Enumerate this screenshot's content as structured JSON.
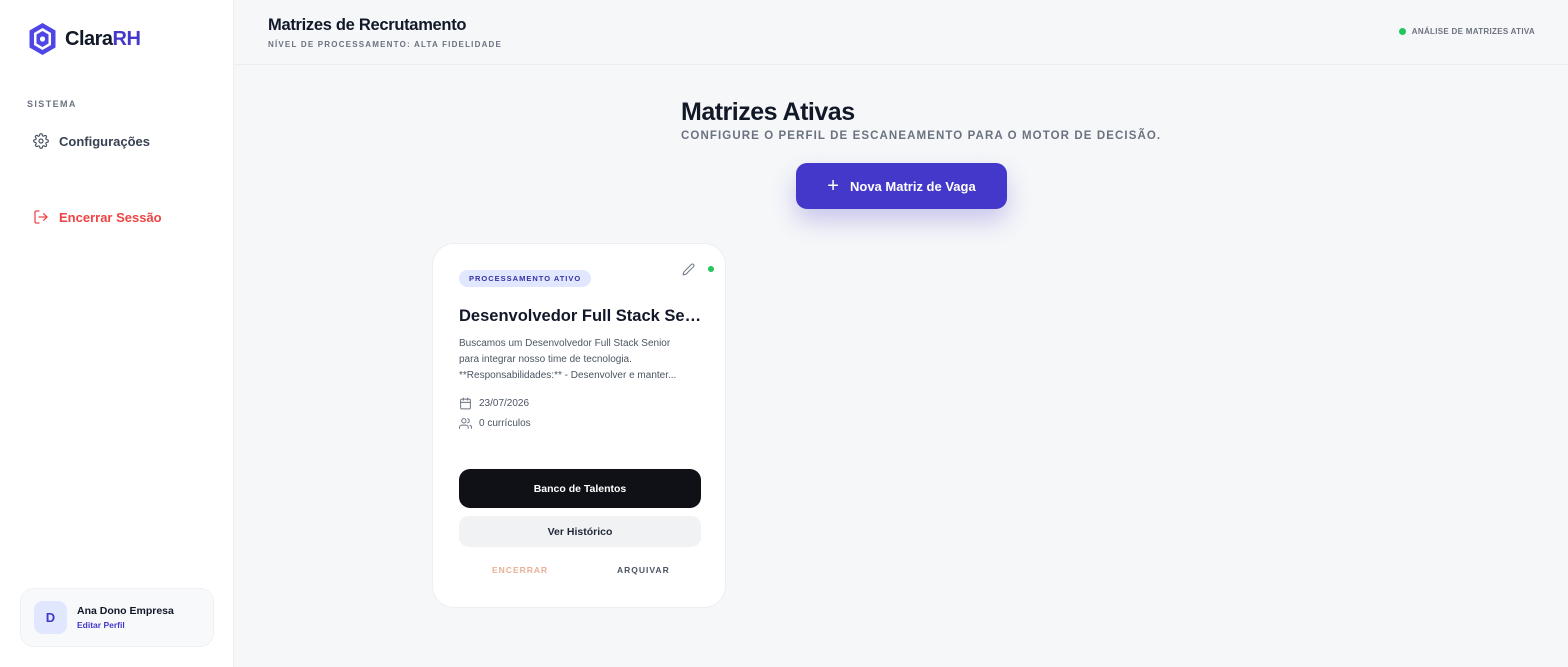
{
  "brand": {
    "name_prefix": "Clara",
    "name_suffix": "RH",
    "accent_color": "#4338ca"
  },
  "sidebar": {
    "section_label": "SISTEMA",
    "items": [
      {
        "label": "Configurações",
        "icon": "gear-icon"
      },
      {
        "label": "Encerrar Sessão",
        "icon": "logout-icon",
        "color": "#ef4444"
      }
    ],
    "profile": {
      "initial": "D",
      "name": "Ana Dono Empresa",
      "edit_label": "Editar Perfil"
    }
  },
  "header": {
    "title": "Matrizes de Recrutamento",
    "subtitle": "NÍVEL DE PROCESSAMENTO: ALTA FIDELIDADE",
    "status_text": "ANÁLISE DE MATRIZES ATIVA",
    "status_color": "#22c55e"
  },
  "main": {
    "title": "Matrizes Ativas",
    "subtitle": "CONFIGURE O PERFIL DE ESCANEAMENTO PARA O MOTOR DE DECISÃO.",
    "new_button_label": "Nova Matriz de Vaga"
  },
  "card": {
    "badge": "PROCESSAMENTO ATIVO",
    "title": "Desenvolvedor Full Stack Senior",
    "description_lines": [
      "Buscamos um Desenvolvedor Full Stack Senior",
      "para integrar nosso time de tecnologia.",
      "**Responsabilidades:** - Desenvolver e manter..."
    ],
    "date": "23/07/2026",
    "resumes": "0 currículos",
    "primary_button": "Banco de Talentos",
    "secondary_button": "Ver Histórico",
    "close_label": "ENCERRAR",
    "archive_label": "ARQUIVAR"
  }
}
